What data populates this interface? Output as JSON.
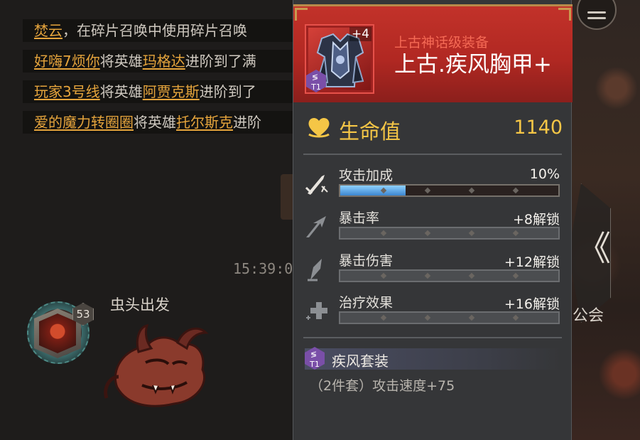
{
  "chat": {
    "lines": [
      {
        "player": "焚云",
        "pre": "",
        "mid": "，在碎片召唤中使用碎片召唤",
        "hero": "",
        "post": ""
      },
      {
        "player": "好嗨7烦你",
        "mid": "将英雄",
        "hero": "玛格达",
        "post": "进阶到了满"
      },
      {
        "player": "玩家3号线",
        "mid": "将英雄",
        "hero": "阿贾克斯",
        "post": "进阶到了"
      },
      {
        "player": "爱的魔力转圈圈",
        "mid": "将英雄",
        "hero": "托尔斯克",
        "post": "进阶"
      }
    ],
    "timestamp": "15:39:0",
    "message": {
      "sender": "虫头出发",
      "avatar_level": "53"
    }
  },
  "world": {
    "guild_label": "公会",
    "collapse_icon": "chevron-left-icon",
    "menu_icon": "hamburger-menu-icon"
  },
  "item": {
    "enhance_level": "+4",
    "tier": "T1",
    "rarity": "上古神话级装备",
    "name": "上古.疾风胸甲+",
    "main_stat": {
      "label": "生命值",
      "value": "1140"
    },
    "sub_stats": [
      {
        "name": "攻击加成",
        "value": "10%",
        "progress": 0.3,
        "locked": false,
        "icon": "attack-bonus-icon"
      },
      {
        "name": "暴击率",
        "value": "+8解锁",
        "progress": 0,
        "locked": true,
        "icon": "crit-rate-icon"
      },
      {
        "name": "暴击伤害",
        "value": "+12解锁",
        "progress": 0,
        "locked": true,
        "icon": "crit-damage-icon"
      },
      {
        "name": "治疗效果",
        "value": "+16解锁",
        "progress": 0,
        "locked": true,
        "icon": "healing-icon"
      }
    ],
    "set": {
      "tier": "T1",
      "name": "疾风套装",
      "effect": "（2件套）攻击速度+75"
    }
  },
  "colors": {
    "gold": "#f5c646",
    "player_link": "#e5a43c",
    "header_red": "#c2322a",
    "bar_blue": "#3c86cf",
    "tier_purple": "#7a4fa8"
  }
}
